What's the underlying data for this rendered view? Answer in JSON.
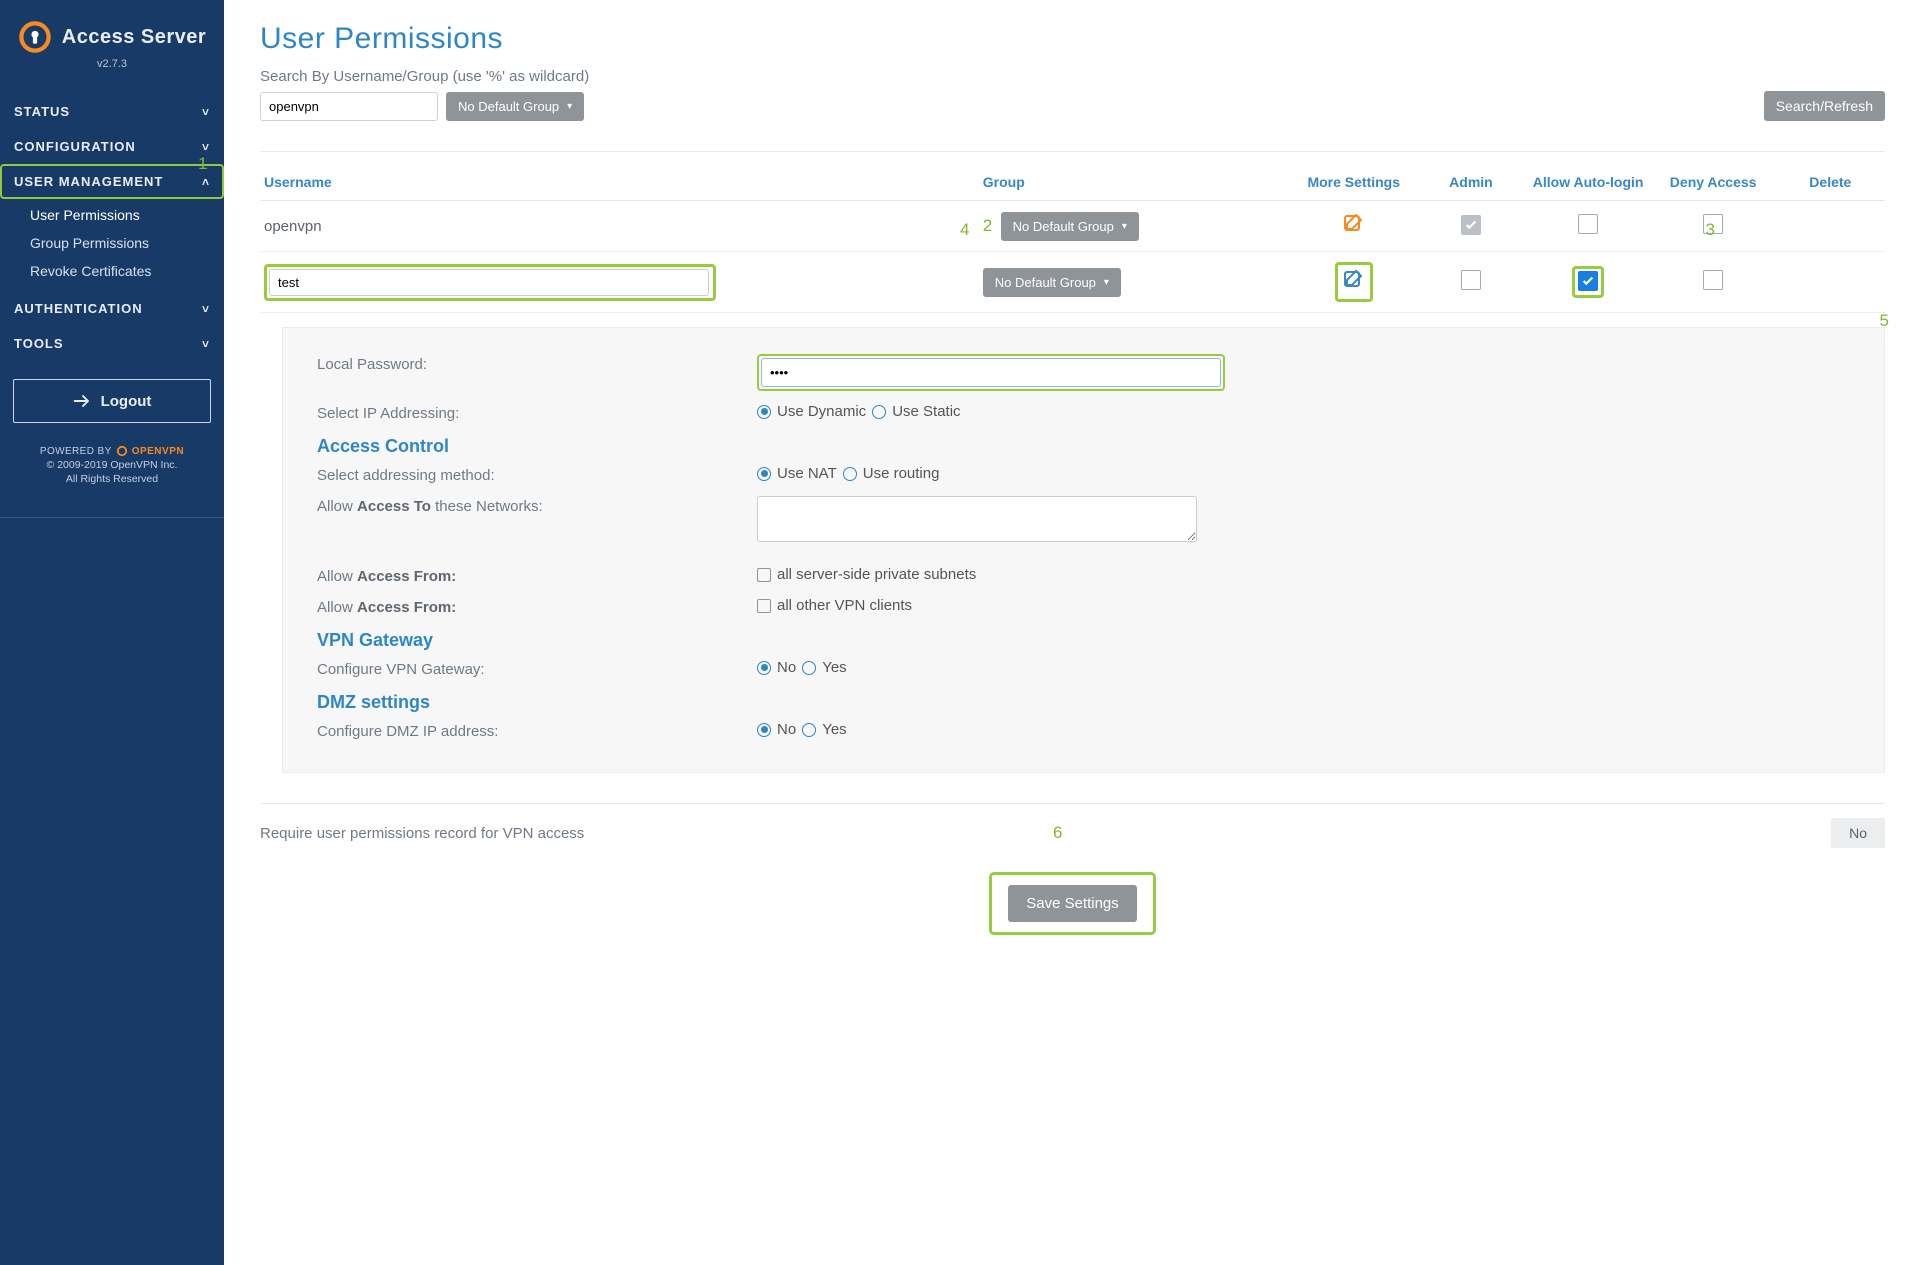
{
  "sidebar": {
    "brand": "Access Server",
    "version": "v2.7.3",
    "items": [
      {
        "label": "Status",
        "expanded": false
      },
      {
        "label": "Configuration",
        "expanded": false
      },
      {
        "label": "User  Management",
        "expanded": true,
        "sub": [
          {
            "label": "User Permissions",
            "current": true
          },
          {
            "label": "Group Permissions"
          },
          {
            "label": "Revoke Certificates"
          }
        ]
      },
      {
        "label": "Authentication",
        "expanded": false
      },
      {
        "label": "Tools",
        "expanded": false
      }
    ],
    "logout": "Logout",
    "powered_by_prefix": "POWERED BY",
    "powered_by_brand": "OPENVPN",
    "copyright": "© 2009-2019 OpenVPN Inc.",
    "rights": "All Rights Reserved"
  },
  "page": {
    "title": "User Permissions",
    "search_label": "Search By Username/Group (use '%' as wildcard)",
    "search_value": "openvpn",
    "group_filter": "No Default Group",
    "search_btn": "Search/Refresh"
  },
  "table": {
    "headers": {
      "username": "Username",
      "group": "Group",
      "more": "More Settings",
      "admin": "Admin",
      "autologin": "Allow Auto-login",
      "deny": "Deny Access",
      "delete": "Delete"
    },
    "rows": [
      {
        "username": "openvpn",
        "group": "No Default Group",
        "admin_locked": true,
        "autologin": false,
        "deny": false,
        "more_color": "#f78b1f"
      },
      {
        "username_input": "test",
        "group": "No Default Group",
        "admin_locked": false,
        "autologin": true,
        "deny": false,
        "more_color": "#3887c6",
        "highlight": true
      }
    ]
  },
  "annotations": {
    "n1": "1",
    "n2": "2",
    "n3": "3",
    "n4": "4",
    "n5": "5",
    "n6": "6"
  },
  "details": {
    "local_password_label": "Local Password:",
    "local_password_value": "••••",
    "ip_label": "Select IP Addressing:",
    "ip_dynamic": "Use Dynamic",
    "ip_static": "Use Static",
    "access_control_title": "Access Control",
    "addressing_label": "Select addressing method:",
    "addr_nat": "Use NAT",
    "addr_routing": "Use routing",
    "allow_access_to_pre": "Allow ",
    "allow_access_to_bold": "Access To",
    "allow_access_to_post": " these Networks:",
    "allow_from1_pre": "Allow ",
    "allow_from1_bold": "Access From:",
    "allow_from1_opt": "all server-side private subnets",
    "allow_from2_pre": "Allow ",
    "allow_from2_bold": "Access From:",
    "allow_from2_opt": "all other VPN clients",
    "vpn_gateway_title": "VPN Gateway",
    "vpn_gateway_label": "Configure VPN Gateway:",
    "dmz_title": "DMZ settings",
    "dmz_label": "Configure DMZ IP address:",
    "no": "No",
    "yes": "Yes"
  },
  "footer": {
    "require_label": "Require user permissions record for VPN access",
    "require_value": "No",
    "save": "Save Settings"
  }
}
